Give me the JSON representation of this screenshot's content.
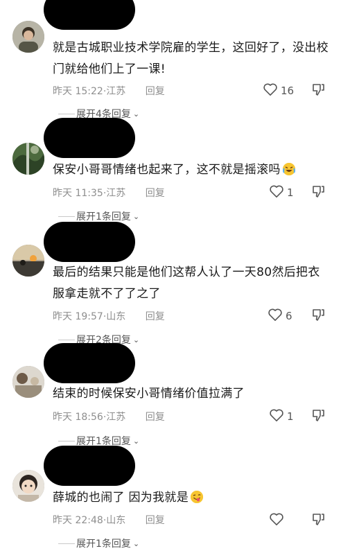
{
  "comments": [
    {
      "text": "就是古城职业技术学院雇的学生，这回好了，没出校门就给他们上了一课!",
      "date": "昨天",
      "time": "15:22",
      "location": "江苏",
      "reply_label": "回复",
      "likes": "16",
      "expand_label": "展开4条回复",
      "emoji": ""
    },
    {
      "text": "保安小哥哥情绪也起来了，这不就是摇滚吗",
      "date": "昨天",
      "time": "11:35",
      "location": "江苏",
      "reply_label": "回复",
      "likes": "1",
      "expand_label": "展开1条回复",
      "emoji": "laughing-crying"
    },
    {
      "text": "最后的结果只能是他们这帮人认了一天80然后把衣服拿走就不了了之了",
      "date": "昨天",
      "time": "19:57",
      "location": "山东",
      "reply_label": "回复",
      "likes": "6",
      "expand_label": "展开2条回复",
      "emoji": ""
    },
    {
      "text": "结束的时候保安小哥情绪价值拉满了",
      "date": "昨天",
      "time": "18:56",
      "location": "江苏",
      "reply_label": "回复",
      "likes": "1",
      "expand_label": "展开1条回复",
      "emoji": ""
    },
    {
      "text": "薛城的也闹了 因为我就是",
      "date": "昨天",
      "time": "22:48",
      "location": "山东",
      "reply_label": "回复",
      "likes": "",
      "expand_label": "展开1条回复",
      "emoji": "winking-tongue"
    }
  ],
  "meta_separator": "·",
  "colors": {
    "meta_gray": "#8e8e8e",
    "text": "#1a1a1a",
    "emoji_yellow": "#f7c531"
  }
}
